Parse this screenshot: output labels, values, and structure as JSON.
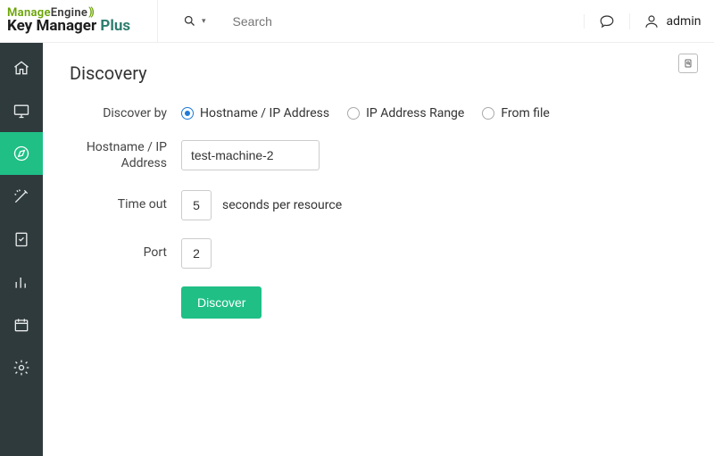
{
  "brand": {
    "line1a": "Manage",
    "line1b": "Engine",
    "line2a": "Key Manager ",
    "line2b": "Plus"
  },
  "topbar": {
    "search_placeholder": "Search",
    "user_label": "admin"
  },
  "sidebar": {
    "items": [
      {
        "name": "home"
      },
      {
        "name": "monitor"
      },
      {
        "name": "discovery",
        "active": true
      },
      {
        "name": "wizard"
      },
      {
        "name": "tasks"
      },
      {
        "name": "reports"
      },
      {
        "name": "schedule"
      },
      {
        "name": "settings"
      }
    ]
  },
  "page": {
    "title": "Discovery",
    "labels": {
      "discover_by": "Discover by",
      "hostname": "Hostname / IP Address",
      "timeout": "Time out",
      "port": "Port"
    },
    "radios": {
      "hostname": "Hostname / IP Address",
      "range": "IP Address Range",
      "file": "From file",
      "selected": "hostname"
    },
    "fields": {
      "hostname_value": "test-machine-2",
      "timeout_value": "5",
      "timeout_suffix": "seconds per resource",
      "port_value": "2"
    },
    "buttons": {
      "discover": "Discover"
    }
  }
}
